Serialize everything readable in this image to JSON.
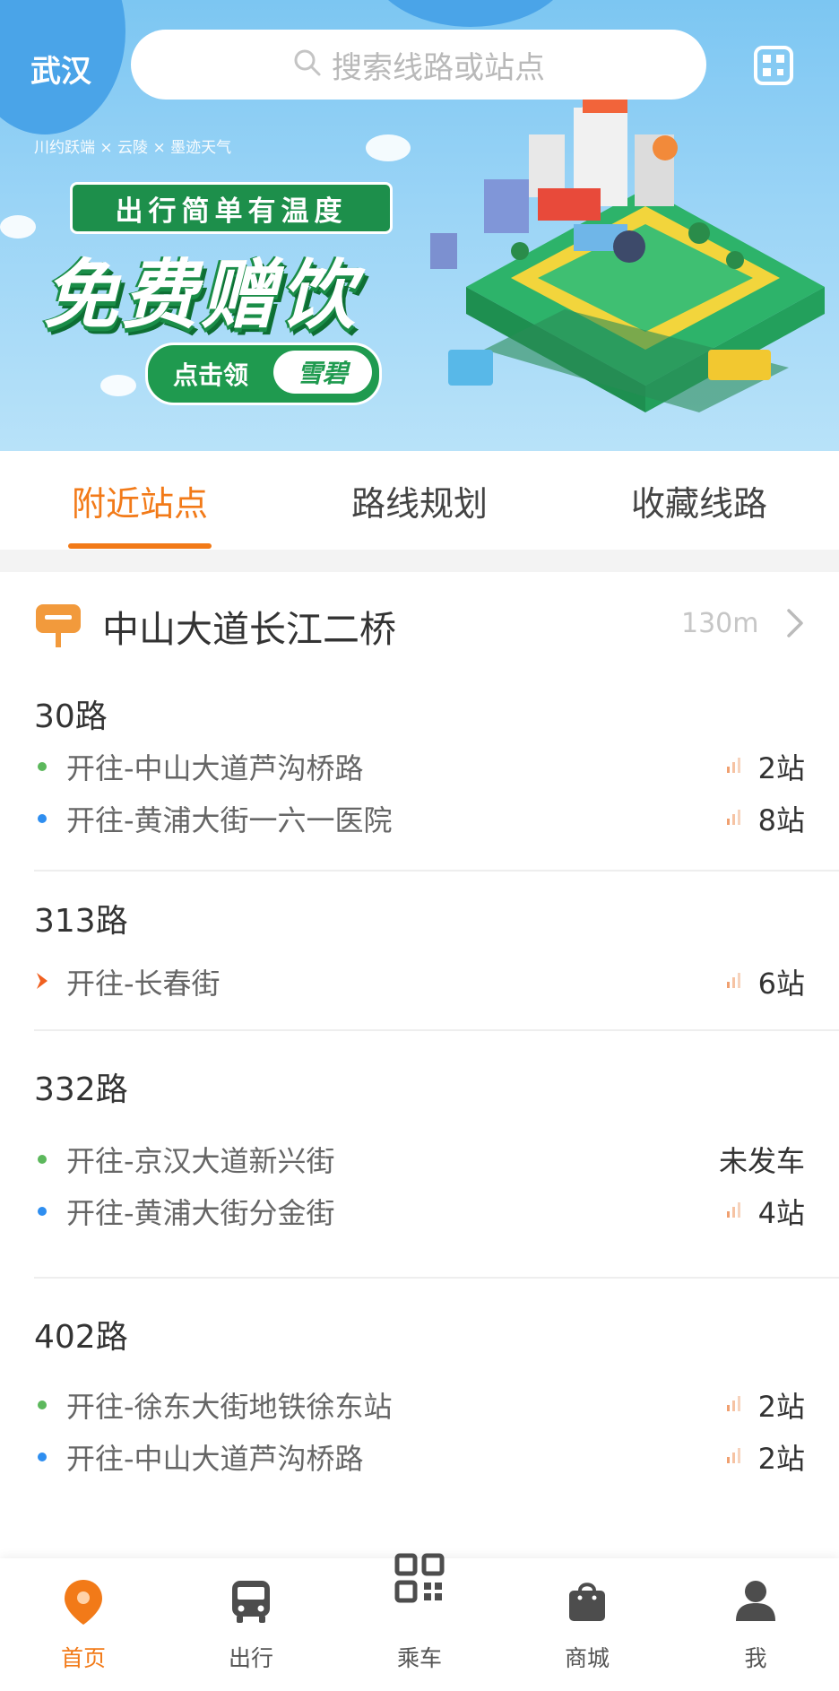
{
  "header": {
    "city": "武汉",
    "search_placeholder": "搜索线路或站点"
  },
  "banner": {
    "partners": "川约跃端 × 云陵 × 墨迹天气",
    "slogan": "出行简单有温度",
    "headline": "免费赠饮",
    "claim_label": "点击领",
    "brand": "雪碧"
  },
  "tabs": [
    {
      "label": "附近站点",
      "active": true
    },
    {
      "label": "路线规划",
      "active": false
    },
    {
      "label": "收藏线路",
      "active": false
    }
  ],
  "stop": {
    "name": "中山大道长江二桥",
    "distance": "130m"
  },
  "routes": [
    {
      "name": "30路",
      "directions": [
        {
          "text": "开往-中山大道芦沟桥路",
          "count": "2站",
          "marker": "green-dot"
        },
        {
          "text": "开往-黄浦大街一六一医院",
          "count": "8站",
          "marker": "blue-dot"
        }
      ]
    },
    {
      "name": "313路",
      "directions": [
        {
          "text": "开往-长春街",
          "count": "6站",
          "marker": "orange-arrow"
        }
      ]
    },
    {
      "name": "332路",
      "directions": [
        {
          "text": "开往-京汉大道新兴街",
          "count": "未发车",
          "marker": "green-dot"
        },
        {
          "text": "开往-黄浦大街分金街",
          "count": "4站",
          "marker": "blue-dot"
        }
      ]
    },
    {
      "name": "402路",
      "directions": [
        {
          "text": "开往-徐东大街地铁徐东站",
          "count": "2站",
          "marker": "green-dot"
        },
        {
          "text": "开往-中山大道芦沟桥路",
          "count": "2站",
          "marker": "blue-dot"
        }
      ]
    }
  ],
  "nav": [
    {
      "label": "首页",
      "icon": "location-pin-icon",
      "active": true
    },
    {
      "label": "出行",
      "icon": "bus-icon",
      "active": false
    },
    {
      "label": "乘车",
      "icon": "qr-code-icon",
      "active": false
    },
    {
      "label": "商城",
      "icon": "shopping-bag-icon",
      "active": false
    },
    {
      "label": "我",
      "icon": "user-icon",
      "active": false
    }
  ],
  "colors": {
    "accent": "#f27a18",
    "green_dot": "#5cb85c",
    "blue_dot": "#2e8ef0",
    "signal": "#f0a070"
  }
}
